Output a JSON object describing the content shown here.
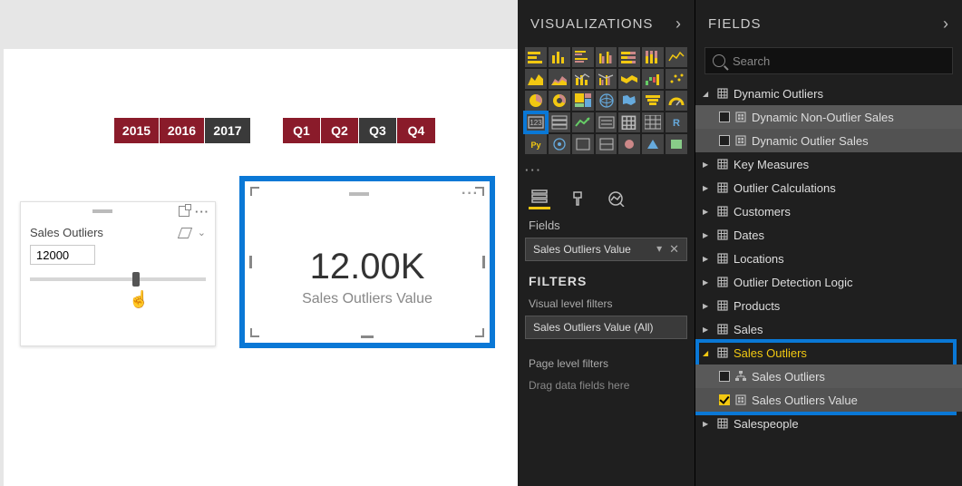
{
  "panels": {
    "visualizations": "VISUALIZATIONS",
    "fields_title": "FIELDS",
    "fields_label": "Fields",
    "filters_title": "FILTERS",
    "visual_filters": "Visual level filters",
    "page_filters": "Page level filters",
    "drag_hint": "Drag data fields here",
    "search_placeholder": "Search"
  },
  "years": {
    "items": [
      "2015",
      "2016",
      "2017"
    ],
    "selected": "2017"
  },
  "quarters": {
    "items": [
      "Q1",
      "Q2",
      "Q3",
      "Q4"
    ],
    "selected": "Q3"
  },
  "slicer": {
    "title": "Sales Outliers",
    "value": "12000"
  },
  "card": {
    "value": "12.00K",
    "label": "Sales Outliers Value"
  },
  "well": {
    "field": "Sales Outliers Value"
  },
  "filter_item": {
    "label": "Sales Outliers Value",
    "scope": "(All)"
  },
  "tree": {
    "t0": {
      "name": "Dynamic Outliers"
    },
    "t0a": {
      "name": "Dynamic Non-Outlier Sales"
    },
    "t0b": {
      "name": "Dynamic Outlier Sales"
    },
    "t1": {
      "name": "Key Measures"
    },
    "t2": {
      "name": "Outlier Calculations"
    },
    "t3": {
      "name": "Customers"
    },
    "t4": {
      "name": "Dates"
    },
    "t5": {
      "name": "Locations"
    },
    "t6": {
      "name": "Outlier Detection Logic"
    },
    "t7": {
      "name": "Products"
    },
    "t8": {
      "name": "Sales"
    },
    "t9": {
      "name": "Sales Outliers"
    },
    "t9a": {
      "name": "Sales Outliers"
    },
    "t9b": {
      "name": "Sales Outliers Value"
    },
    "t10": {
      "name": "Salespeople"
    }
  }
}
